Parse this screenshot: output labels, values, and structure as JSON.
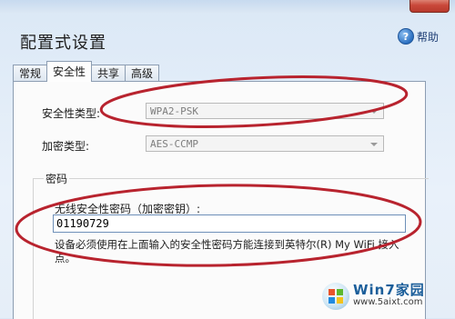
{
  "window": {
    "title": "配置式设置",
    "help_label": "帮助"
  },
  "tabs": [
    {
      "label": "常规",
      "active": false
    },
    {
      "label": "安全性",
      "active": true
    },
    {
      "label": "共享",
      "active": false
    },
    {
      "label": "高级",
      "active": false
    }
  ],
  "security": {
    "type_label": "安全性类型:",
    "type_value": "WPA2-PSK",
    "encryption_label": "加密类型:",
    "encryption_value": "AES-CCMP"
  },
  "password_group": {
    "title": "密码",
    "field_label": "无线安全性密码（加密密钥）:",
    "field_value": "01190729",
    "note": "设备必须使用在上面输入的安全性密码方能连接到英特尔(R) My WiFi 接入点。"
  },
  "watermark": {
    "title": "Win7家园",
    "url": "www.5aixt.com"
  },
  "colors": {
    "annotation": "#b8232e",
    "input_border": "#6d8fb8"
  }
}
